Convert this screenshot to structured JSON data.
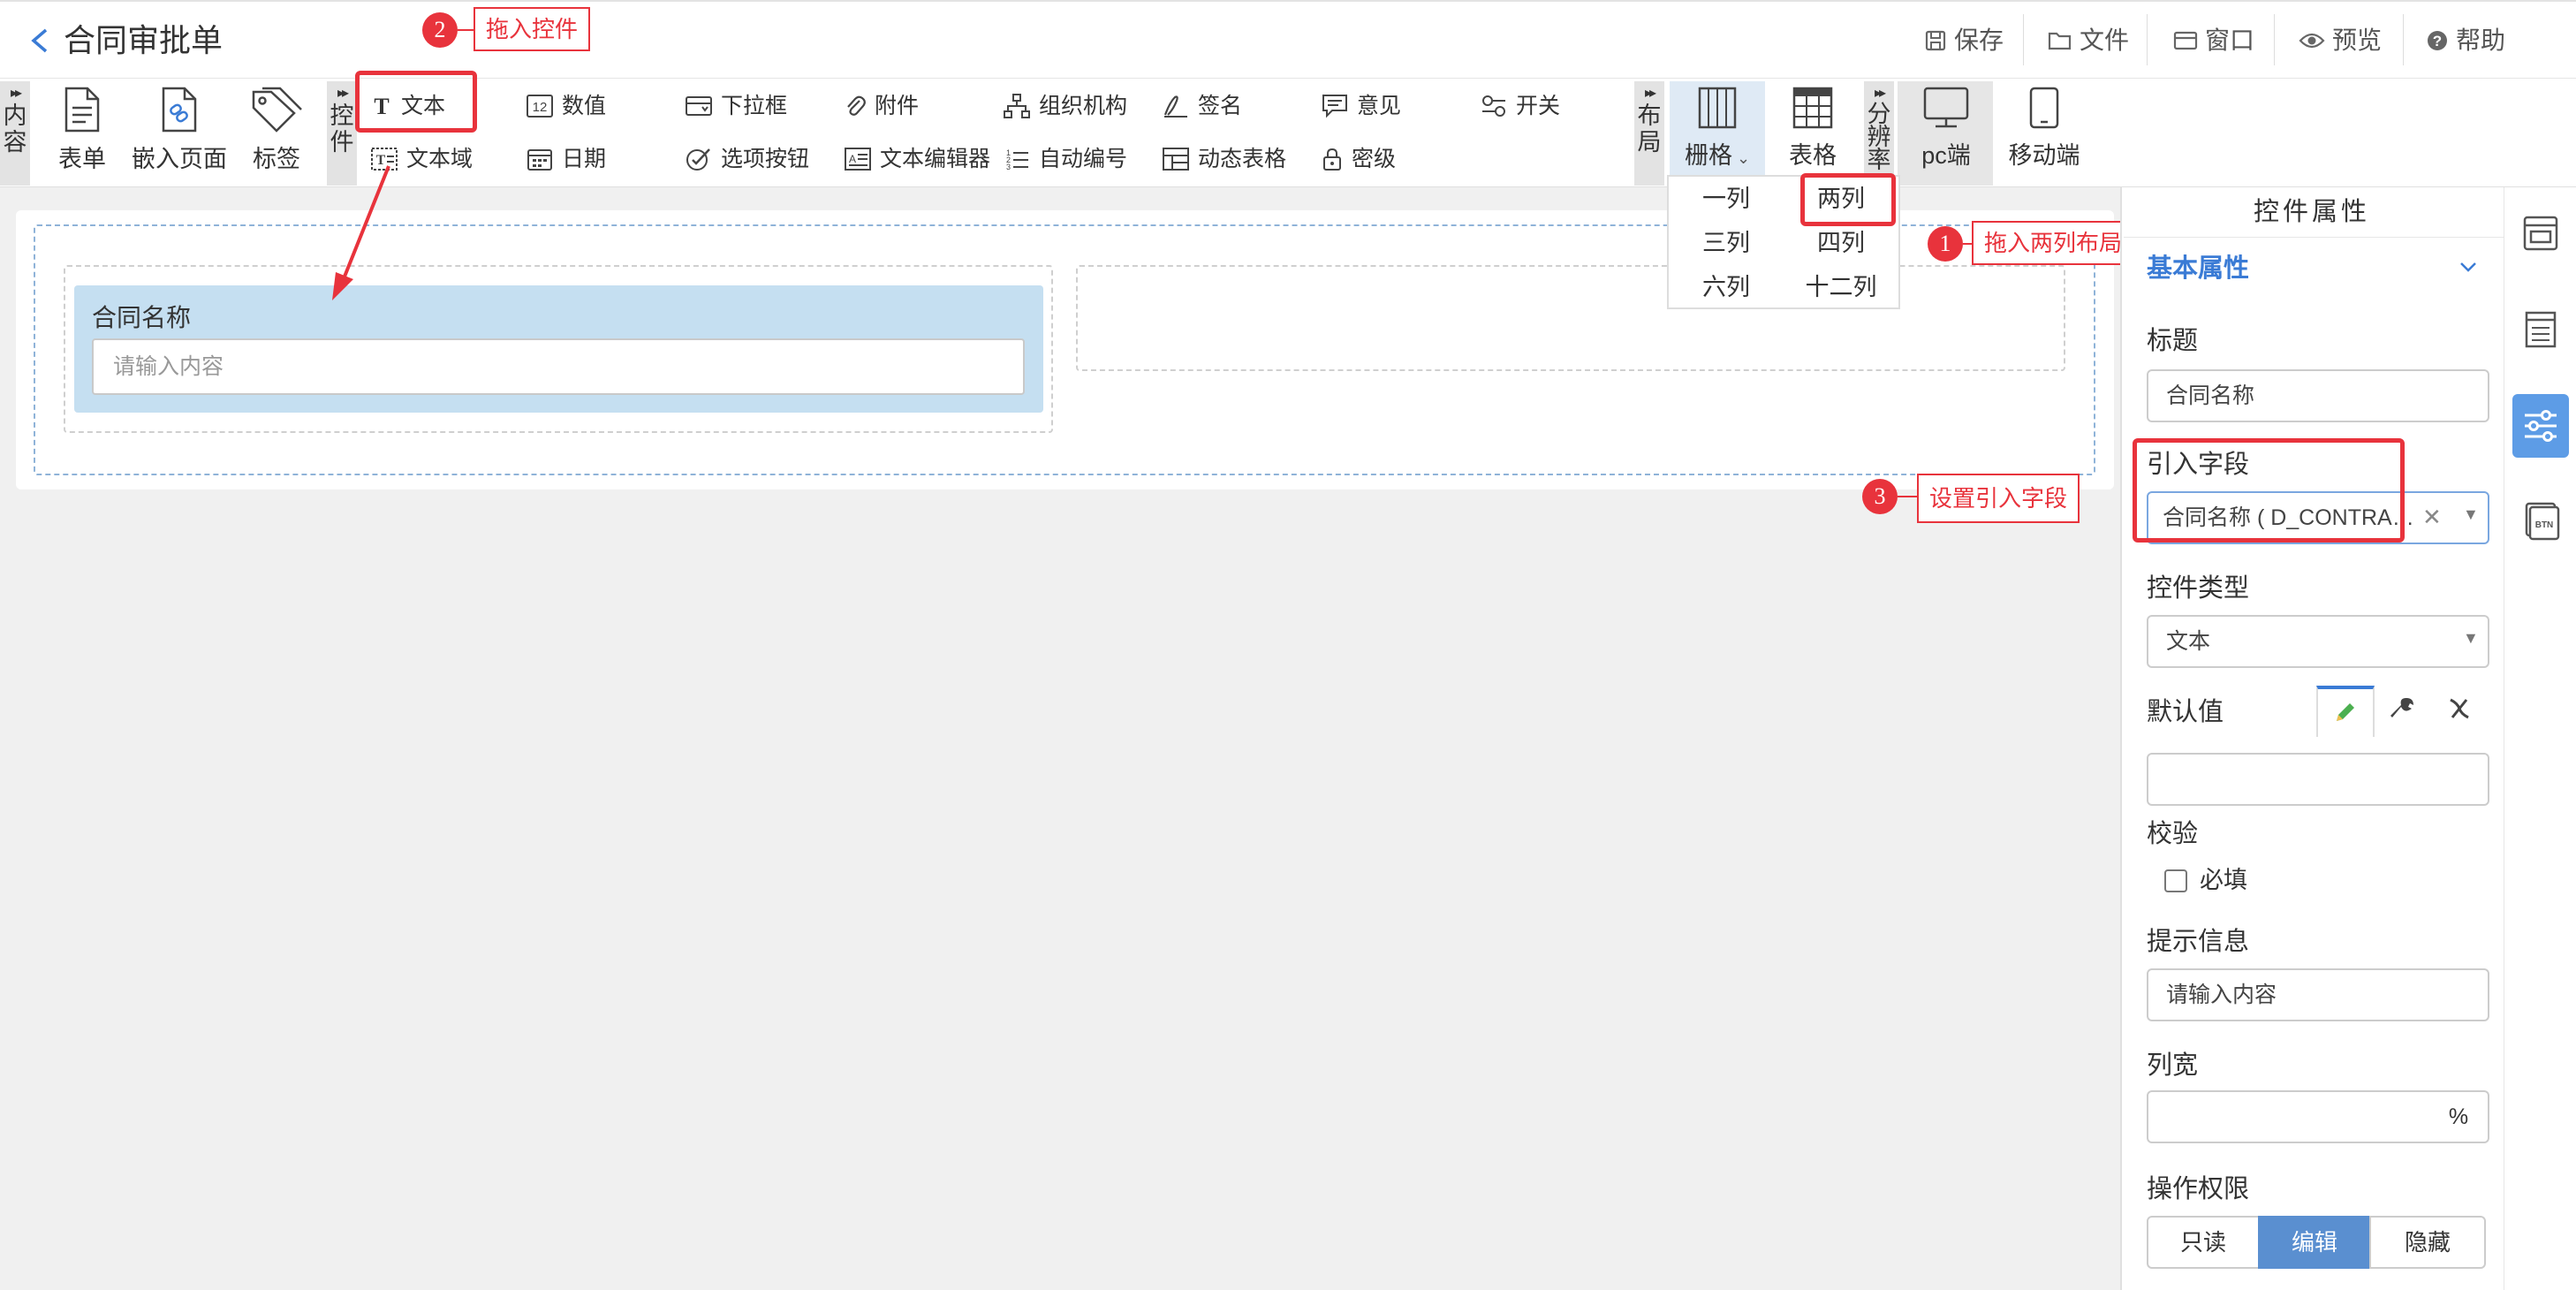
{
  "header": {
    "title": "合同审批单",
    "actions": {
      "save": "保存",
      "file": "文件",
      "window": "窗口",
      "preview": "预览",
      "help": "帮助"
    }
  },
  "toolbar": {
    "content_group": "内容",
    "content_items": [
      "表单",
      "嵌入页面",
      "标签"
    ],
    "controls_group": "控件",
    "controls_row1": [
      "文本",
      "数值",
      "下拉框",
      "附件",
      "组织机构",
      "签名",
      "意见",
      "开关"
    ],
    "controls_row2": [
      "文本域",
      "日期",
      "选项按钮",
      "文本编辑器",
      "自动编号",
      "动态表格",
      "密级"
    ],
    "layout_group": "布局",
    "layout_items": [
      "栅格",
      "表格"
    ],
    "resolution_group": "分辨率",
    "resolution_items": [
      "pc端",
      "移动端"
    ]
  },
  "layout_dropdown": [
    "一列",
    "两列",
    "三列",
    "四列",
    "六列",
    "十二列"
  ],
  "annotations": {
    "step1": {
      "num": "1",
      "text": "拖入两列布局"
    },
    "step2": {
      "num": "2",
      "text": "拖入控件"
    },
    "step3": {
      "num": "3",
      "text": "设置引入字段"
    }
  },
  "canvas": {
    "field_label": "合同名称",
    "field_placeholder": "请输入内容"
  },
  "properties": {
    "panel_title": "控件属性",
    "section": "基本属性",
    "title_label": "标题",
    "title_value": "合同名称",
    "source_field_label": "引入字段",
    "source_field_value": "合同名称 ( D_CONTRA…",
    "control_type_label": "控件类型",
    "control_type_value": "文本",
    "default_label": "默认值",
    "default_value": "",
    "validation_label": "校验",
    "required_label": "必填",
    "required_checked": false,
    "hint_label": "提示信息",
    "hint_value": "请输入内容",
    "width_label": "列宽",
    "width_value": "",
    "width_unit": "%",
    "permission_label": "操作权限",
    "permission_options": [
      "只读",
      "编辑",
      "隐藏"
    ],
    "permission_selected": "编辑"
  },
  "colors": {
    "accent": "#3a7bd5",
    "annotation": "#e8333c",
    "field_bg": "#c5dff1",
    "active_btn": "#5a8fd0"
  }
}
